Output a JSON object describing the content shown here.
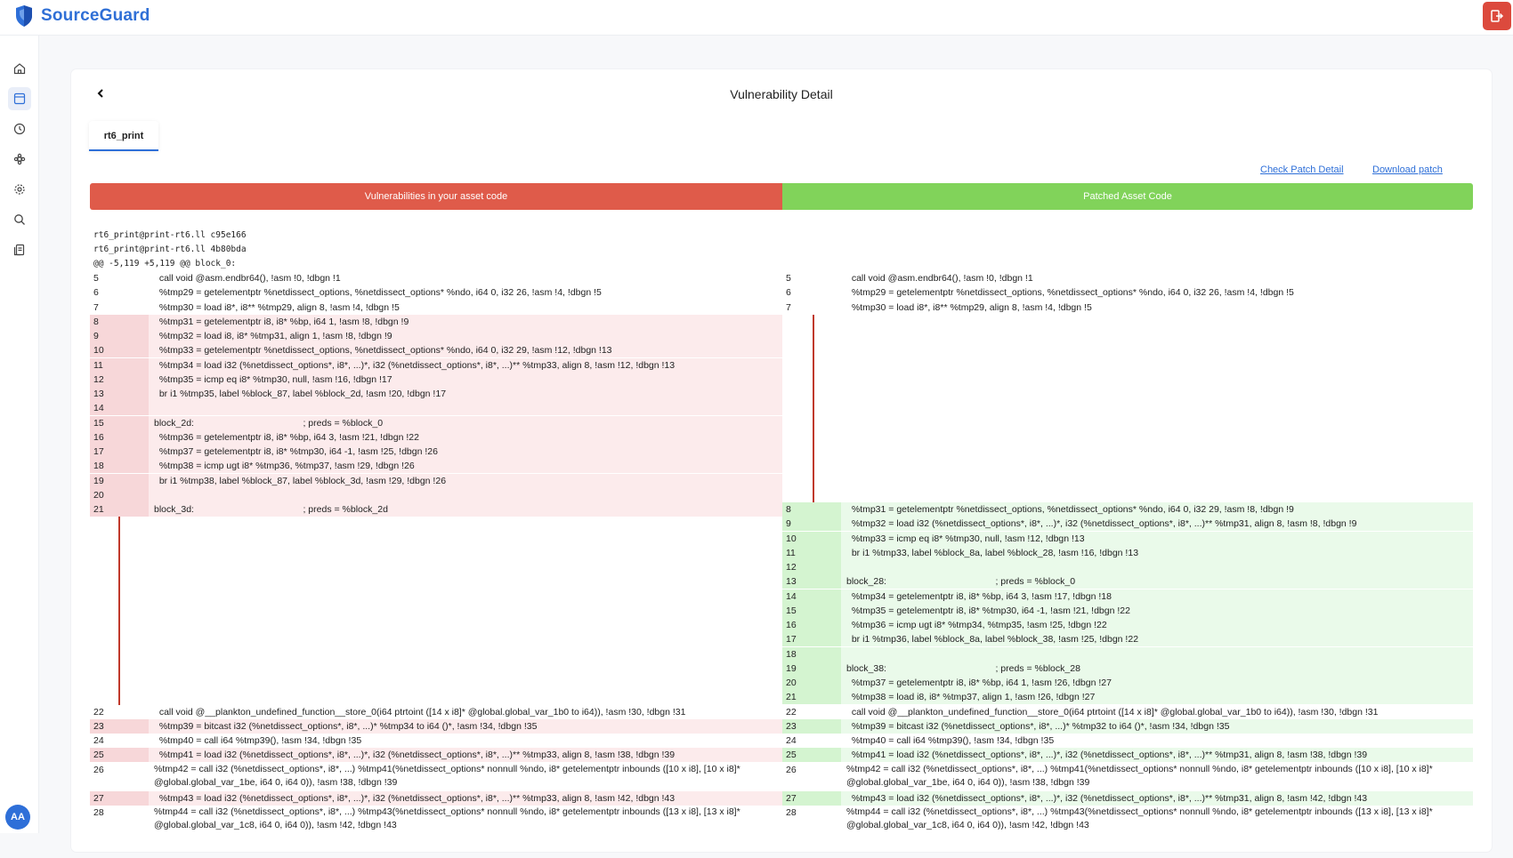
{
  "app": {
    "name": "SourceGuard"
  },
  "header": {
    "logout_icon": "logout-icon"
  },
  "sidebar": {
    "items": [
      {
        "name": "home-icon"
      },
      {
        "name": "dashboard-icon"
      },
      {
        "name": "history-icon"
      },
      {
        "name": "puzzle-icon"
      },
      {
        "name": "settings-icon"
      },
      {
        "name": "search-icon"
      },
      {
        "name": "report-icon"
      }
    ],
    "avatar": "AA"
  },
  "page": {
    "title": "Vulnerability Detail",
    "tab": "rt6_print",
    "links": {
      "check": "Check Patch Detail",
      "download": "Download patch"
    },
    "bars": {
      "left": "Vulnerabilities in your asset code",
      "right": "Patched Asset Code"
    },
    "meta": [
      "rt6_print@print-rt6.ll c95e166",
      "rt6_print@print-rt6.ll 4b80bda",
      "@@ -5,119 +5,119 @@ block_0:"
    ]
  },
  "colors": {
    "brand": "#2e6fd8",
    "removed": "#df5b4a",
    "added": "#81d35a",
    "logout": "#dc4a3d"
  },
  "left_rows": [
    {
      "ln": "5",
      "code": "  call void @asm.endbr64(), !asm !0, !dbgn !1",
      "type": "ctx"
    },
    {
      "ln": "6",
      "code": "  %tmp29 = getelementptr %netdissect_options, %netdissect_options* %ndo, i64 0, i32 26, !asm !4, !dbgn !5",
      "type": "ctx"
    },
    {
      "ln": "7",
      "code": "  %tmp30 = load i8*, i8** %tmp29, align 8, !asm !4, !dbgn !5",
      "type": "ctx"
    },
    {
      "ln": "8",
      "code": "  %tmp31 = getelementptr i8, i8* %bp, i64 1, !asm !8, !dbgn !9",
      "type": "del"
    },
    {
      "ln": "9",
      "code": "  %tmp32 = load i8, i8* %tmp31, align 1, !asm !8, !dbgn !9",
      "type": "del"
    },
    {
      "ln": "10",
      "code": "  %tmp33 = getelementptr %netdissect_options, %netdissect_options* %ndo, i64 0, i32 29, !asm !12, !dbgn !13",
      "type": "del"
    },
    {
      "ln": "11",
      "code": "  %tmp34 = load i32 (%netdissect_options*, i8*, ...)*, i32 (%netdissect_options*, i8*, ...)** %tmp33, align 8, !asm !12, !dbgn !13",
      "type": "del"
    },
    {
      "ln": "12",
      "code": "  %tmp35 = icmp eq i8* %tmp30, null, !asm !16, !dbgn !17",
      "type": "del"
    },
    {
      "ln": "13",
      "code": "  br i1 %tmp35, label %block_87, label %block_2d, !asm !20, !dbgn !17",
      "type": "del"
    },
    {
      "ln": "14",
      "code": "",
      "type": "del"
    },
    {
      "ln": "15",
      "code": "block_2d:                                          ; preds = %block_0",
      "type": "del"
    },
    {
      "ln": "16",
      "code": "  %tmp36 = getelementptr i8, i8* %bp, i64 3, !asm !21, !dbgn !22",
      "type": "del"
    },
    {
      "ln": "17",
      "code": "  %tmp37 = getelementptr i8, i8* %tmp30, i64 -1, !asm !25, !dbgn !26",
      "type": "del"
    },
    {
      "ln": "18",
      "code": "  %tmp38 = icmp ugt i8* %tmp36, %tmp37, !asm !29, !dbgn !26",
      "type": "del"
    },
    {
      "ln": "19",
      "code": "  br i1 %tmp38, label %block_87, label %block_3d, !asm !29, !dbgn !26",
      "type": "del"
    },
    {
      "ln": "20",
      "code": "",
      "type": "del"
    },
    {
      "ln": "21",
      "code": "block_3d:                                          ; preds = %block_2d",
      "type": "del"
    },
    {
      "ln": "22",
      "code": "  call void @__plankton_undefined_function__store_0(i64 ptrtoint ([14 x i8]* @global.global_var_1b0 to i64)), !asm !30, !dbgn !31",
      "type": "ctx",
      "row": 30
    },
    {
      "ln": "23",
      "code": "  %tmp39 = bitcast i32 (%netdissect_options*, i8*, ...)* %tmp34 to i64 ()*, !asm !34, !dbgn !35",
      "type": "del",
      "row": 31
    },
    {
      "ln": "24",
      "code": "  %tmp40 = call i64 %tmp39(), !asm !34, !dbgn !35",
      "type": "ctx",
      "row": 32
    },
    {
      "ln": "25",
      "code": "  %tmp41 = load i32 (%netdissect_options*, i8*, ...)*, i32 (%netdissect_options*, i8*, ...)** %tmp33, align 8, !asm !38, !dbgn !39",
      "type": "del",
      "row": 33
    },
    {
      "ln": "26",
      "code": "  %tmp42 = call i32 (%netdissect_options*, i8*, ...) %tmp41(%netdissect_options* nonnull %ndo, i8* getelementptr inbounds ([10 x i8], [10 x i8]* @global.global_var_1be, i64 0, i64 0)), !asm !38, !dbgn !39",
      "type": "ctx",
      "row": 34,
      "tall": true
    },
    {
      "ln": "27",
      "code": "  %tmp43 = load i32 (%netdissect_options*, i8*, ...)*, i32 (%netdissect_options*, i8*, ...)** %tmp33, align 8, !asm !42, !dbgn !43",
      "type": "del",
      "row": 36
    },
    {
      "ln": "28",
      "code": "  %tmp44 = call i32 (%netdissect_options*, i8*, ...) %tmp43(%netdissect_options* nonnull %ndo, i8* getelementptr inbounds ([13 x i8], [13 x i8]* @global.global_var_1c8, i64 0, i64 0)), !asm !42, !dbgn !43",
      "type": "ctx",
      "row": 37,
      "tall": true
    }
  ],
  "right_rows": [
    {
      "ln": "5",
      "code": "  call void @asm.endbr64(), !asm !0, !dbgn !1",
      "type": "ctx",
      "row": 0
    },
    {
      "ln": "6",
      "code": "  %tmp29 = getelementptr %netdissect_options, %netdissect_options* %ndo, i64 0, i32 26, !asm !4, !dbgn !5",
      "type": "ctx",
      "row": 1
    },
    {
      "ln": "7",
      "code": "  %tmp30 = load i8*, i8** %tmp29, align 8, !asm !4, !dbgn !5",
      "type": "ctx",
      "row": 2
    },
    {
      "ln": "8",
      "code": "  %tmp31 = getelementptr %netdissect_options, %netdissect_options* %ndo, i64 0, i32 29, !asm !8, !dbgn !9",
      "type": "add",
      "row": 16
    },
    {
      "ln": "9",
      "code": "  %tmp32 = load i32 (%netdissect_options*, i8*, ...)*, i32 (%netdissect_options*, i8*, ...)** %tmp31, align 8, !asm !8, !dbgn !9",
      "type": "add",
      "row": 17
    },
    {
      "ln": "10",
      "code": "  %tmp33 = icmp eq i8* %tmp30, null, !asm !12, !dbgn !13",
      "type": "add",
      "row": 18
    },
    {
      "ln": "11",
      "code": "  br i1 %tmp33, label %block_8a, label %block_28, !asm !16, !dbgn !13",
      "type": "add",
      "row": 19
    },
    {
      "ln": "12",
      "code": "",
      "type": "add",
      "row": 20
    },
    {
      "ln": "13",
      "code": "block_28:                                          ; preds = %block_0",
      "type": "add",
      "row": 21
    },
    {
      "ln": "14",
      "code": "  %tmp34 = getelementptr i8, i8* %bp, i64 3, !asm !17, !dbgn !18",
      "type": "add",
      "row": 22
    },
    {
      "ln": "15",
      "code": "  %tmp35 = getelementptr i8, i8* %tmp30, i64 -1, !asm !21, !dbgn !22",
      "type": "add",
      "row": 23
    },
    {
      "ln": "16",
      "code": "  %tmp36 = icmp ugt i8* %tmp34, %tmp35, !asm !25, !dbgn !22",
      "type": "add",
      "row": 24
    },
    {
      "ln": "17",
      "code": "  br i1 %tmp36, label %block_8a, label %block_38, !asm !25, !dbgn !22",
      "type": "add",
      "row": 25
    },
    {
      "ln": "18",
      "code": "",
      "type": "add",
      "row": 26
    },
    {
      "ln": "19",
      "code": "block_38:                                          ; preds = %block_28",
      "type": "add",
      "row": 27
    },
    {
      "ln": "20",
      "code": "  %tmp37 = getelementptr i8, i8* %bp, i64 1, !asm !26, !dbgn !27",
      "type": "add",
      "row": 28
    },
    {
      "ln": "21",
      "code": "  %tmp38 = load i8, i8* %tmp37, align 1, !asm !26, !dbgn !27",
      "type": "add",
      "row": 29
    },
    {
      "ln": "22",
      "code": "  call void @__plankton_undefined_function__store_0(i64 ptrtoint ([14 x i8]* @global.global_var_1b0 to i64)), !asm !30, !dbgn !31",
      "type": "ctx",
      "row": 30
    },
    {
      "ln": "23",
      "code": "  %tmp39 = bitcast i32 (%netdissect_options*, i8*, ...)* %tmp32 to i64 ()*, !asm !34, !dbgn !35",
      "type": "add",
      "row": 31
    },
    {
      "ln": "24",
      "code": "  %tmp40 = call i64 %tmp39(), !asm !34, !dbgn !35",
      "type": "ctx",
      "row": 32
    },
    {
      "ln": "25",
      "code": "  %tmp41 = load i32 (%netdissect_options*, i8*, ...)*, i32 (%netdissect_options*, i8*, ...)** %tmp31, align 8, !asm !38, !dbgn !39",
      "type": "add",
      "row": 33
    },
    {
      "ln": "26",
      "code": "  %tmp42 = call i32 (%netdissect_options*, i8*, ...) %tmp41(%netdissect_options* nonnull %ndo, i8* getelementptr inbounds ([10 x i8], [10 x i8]* @global.global_var_1be, i64 0, i64 0)), !asm !38, !dbgn !39",
      "type": "ctx",
      "row": 34,
      "tall": true
    },
    {
      "ln": "27",
      "code": "  %tmp43 = load i32 (%netdissect_options*, i8*, ...)*, i32 (%netdissect_options*, i8*, ...)** %tmp31, align 8, !asm !42, !dbgn !43",
      "type": "add",
      "row": 36
    },
    {
      "ln": "28",
      "code": "  %tmp44 = call i32 (%netdissect_options*, i8*, ...) %tmp43(%netdissect_options* nonnull %ndo, i8* getelementptr inbounds ([13 x i8], [13 x i8]* @global.global_var_1c8, i64 0, i64 0)), !asm !42, !dbgn !43",
      "type": "ctx",
      "row": 37,
      "tall": true
    }
  ]
}
